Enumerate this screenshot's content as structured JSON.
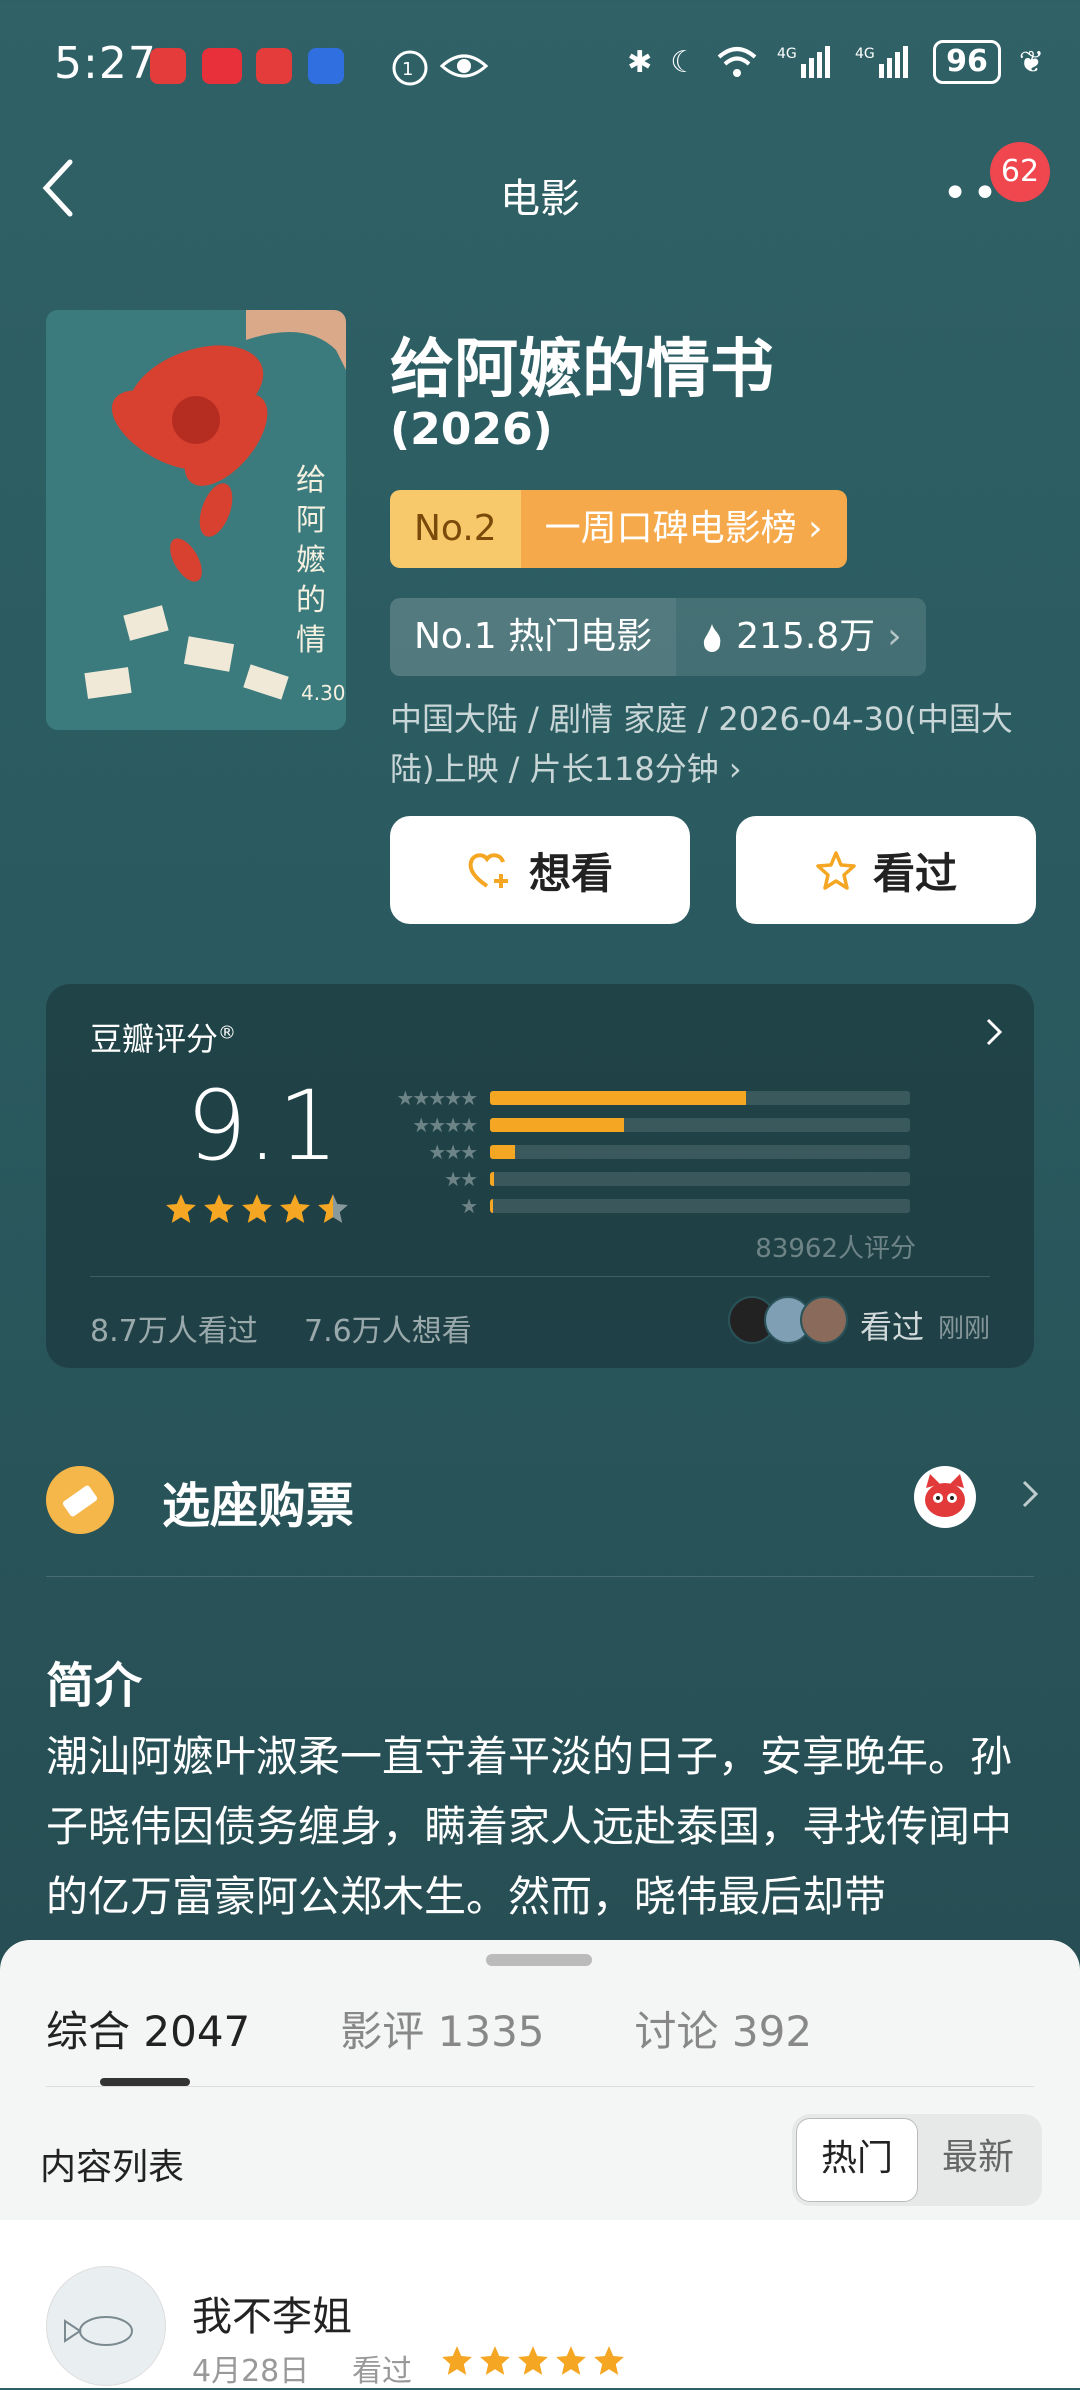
{
  "status": {
    "time": "5:27",
    "battery": "96",
    "app_icons": [
      "HUAWEI",
      "小红书",
      "HUAWEI",
      ""
    ]
  },
  "nav": {
    "title": "电影",
    "notification_count": "62"
  },
  "movie": {
    "title": "给阿嬷的情书",
    "year": "(2026)",
    "rank_no": "No.2",
    "rank_list": "一周口碑电影榜",
    "hot_rank": "No.1 热门电影",
    "hot_count": "215.8万",
    "meta": "中国大陆 / 剧情 家庭 / 2026-04-30(中国大陆)上映 / 片长118分钟",
    "want_label": "想看",
    "seen_label": "看过"
  },
  "rating": {
    "label": "豆瓣评分",
    "score": "9.1",
    "stars": 4.5,
    "distribution": [
      0.61,
      0.32,
      0.06,
      0.01,
      0.005
    ],
    "count": "83962人评分",
    "seen": "8.7万人看过",
    "want": "7.6万人想看",
    "friends_status": "看过",
    "friends_time": "刚刚"
  },
  "ticket": {
    "label": "选座购票"
  },
  "intro": {
    "heading": "简介",
    "text": "潮汕阿嬷叶淑柔一直守着平淡的日子，安享晚年。孙子晓伟因债务缠身，瞒着家人远赴泰国，寻找传闻中的亿万富豪阿公郑木生。然而，晓伟最后却带"
  },
  "sheet": {
    "tabs": [
      {
        "label": "综合",
        "count": "2047"
      },
      {
        "label": "影评",
        "count": "1335"
      },
      {
        "label": "讨论",
        "count": "392"
      }
    ],
    "list_label": "内容列表",
    "sort_hot": "热门",
    "sort_new": "最新",
    "first_item": {
      "user": "我不李姐",
      "date": "4月28日",
      "status": "看过",
      "stars": 5
    }
  },
  "colors": {
    "accent": "#f5a623",
    "bg": "#2a5a5f",
    "badge": "#f0474f"
  }
}
